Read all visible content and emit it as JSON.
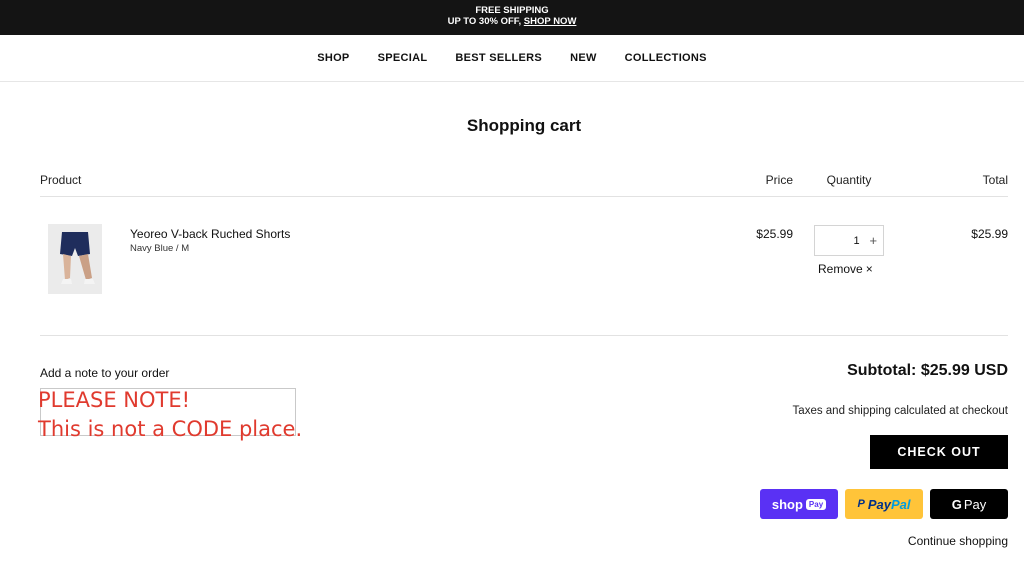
{
  "announcement": {
    "line1": "FREE SHIPPING",
    "line2_prefix": "UP TO 30% OFF, ",
    "line2_link": "SHOP NOW"
  },
  "nav": [
    "SHOP",
    "SPECIAL",
    "BEST SELLERS",
    "NEW",
    "COLLECTIONS"
  ],
  "page_title": "Shopping cart",
  "columns": {
    "product": "Product",
    "price": "Price",
    "quantity": "Quantity",
    "total": "Total"
  },
  "item": {
    "name": "Yeoreo V-back Ruched Shorts",
    "variant": "Navy Blue / M",
    "price": "$25.99",
    "quantity": "1",
    "plus": "+",
    "remove": "Remove",
    "remove_icon": "×",
    "total": "$25.99"
  },
  "note": {
    "label": "Add a note to your order",
    "overlay": "PLEASE NOTE!\nThis is not a CODE place."
  },
  "summary": {
    "subtotal": "Subtotal: $25.99 USD",
    "taxes": "Taxes and shipping calculated at checkout",
    "checkout": "CHECK OUT",
    "continue": "Continue shopping"
  },
  "payments": {
    "shop_pay": {
      "word": "shop",
      "badge": "Pay"
    },
    "paypal": {
      "part1": "Pay",
      "part2": "Pal",
      "mark": "P"
    },
    "gpay": {
      "g": "G",
      "word": "Pay"
    }
  }
}
